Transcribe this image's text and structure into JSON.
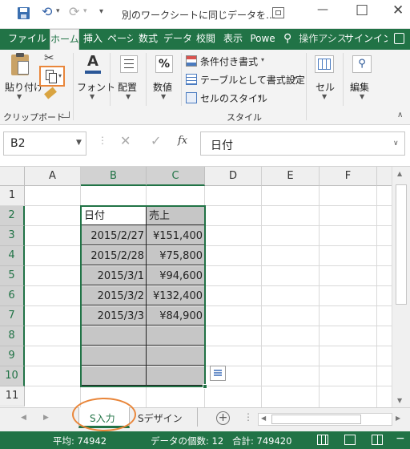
{
  "window": {
    "title": "別のワークシートに同じデータを…",
    "qat": {
      "save": "save-icon",
      "undo": "undo-icon",
      "redo": "redo-icon"
    },
    "controls": {
      "restore": "restore-icon",
      "minimize": "—",
      "maximize": "□"
    }
  },
  "tabs": [
    {
      "label": "ファイル"
    },
    {
      "label": "ホーム"
    },
    {
      "label": "挿入"
    },
    {
      "label": "ページ"
    },
    {
      "label": "数式"
    },
    {
      "label": "データ"
    },
    {
      "label": "校閲"
    },
    {
      "label": "表示"
    },
    {
      "label": "Powe"
    }
  ],
  "tellme": {
    "text": "操作アシス"
  },
  "signin": {
    "text": "サインイン"
  },
  "ribbon": {
    "paste": "貼り付け",
    "clipboard_group": "クリップボード",
    "font": "フォント",
    "alignment": "配置",
    "number": "数値",
    "number_symbol": "%",
    "conditional": "条件付き書式",
    "table_format": "テーブルとして書式設定",
    "cell_styles": "セルのスタイル",
    "styles_group": "スタイル",
    "cells": "セル",
    "edit": "編集",
    "font_letter": "A"
  },
  "formula_bar": {
    "namebox": "B2",
    "fx": "fx",
    "value": "日付"
  },
  "grid": {
    "columns": [
      "A",
      "B",
      "C",
      "D",
      "E",
      "F"
    ],
    "rows": [
      "1",
      "2",
      "3",
      "4",
      "5",
      "6",
      "7",
      "8",
      "9",
      "10",
      "11"
    ],
    "cells": {
      "B2": "日付",
      "C2": "売上",
      "B3": "2015/2/27",
      "C3": "¥151,400",
      "B4": "2015/2/28",
      "C4": "¥75,800",
      "B5": "2015/3/1",
      "C5": "¥94,600",
      "B6": "2015/3/2",
      "C6": "¥132,400",
      "B7": "2015/3/3",
      "C7": "¥84,900"
    }
  },
  "sheets": [
    {
      "name": "S入力",
      "active": true
    },
    {
      "name": "Sデザイン",
      "active": false
    }
  ],
  "status": {
    "average": "平均: 74942",
    "count": "データの個数: 12",
    "sum": "合計: 749420"
  },
  "colors": {
    "excel_green": "#217346",
    "selection_fill": "#c6c6c6",
    "highlight_orange": "#e9863a"
  }
}
